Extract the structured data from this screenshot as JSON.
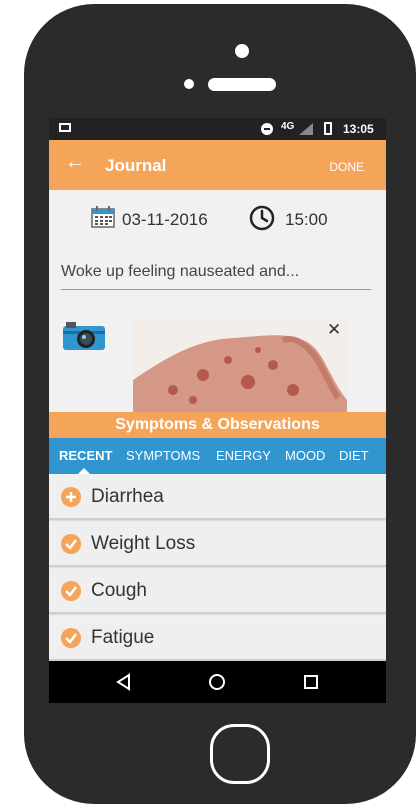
{
  "status_bar": {
    "network": "4G",
    "time": "13:05"
  },
  "app_bar": {
    "back_icon": "arrow-left-icon",
    "title": "Journal",
    "done_label": "DONE"
  },
  "entry": {
    "date": "03-11-2016",
    "time": "15:00",
    "note": "Woke up feeling nauseated and..."
  },
  "photo": {
    "close_label": "✕"
  },
  "symptoms": {
    "header": "Symptoms & Observations",
    "tabs": [
      "RECENT",
      "SYMPTOMS",
      "ENERGY",
      "MOOD",
      "DIET"
    ],
    "active_tab": "RECENT",
    "items": [
      {
        "label": "Diarrhea",
        "state": "add"
      },
      {
        "label": "Weight Loss",
        "state": "checked"
      },
      {
        "label": "Cough",
        "state": "checked"
      },
      {
        "label": "Fatigue",
        "state": "checked"
      }
    ]
  },
  "colors": {
    "accent": "#f5a559",
    "tab_bar": "#3196cf",
    "phone": "#2b2b2b"
  }
}
